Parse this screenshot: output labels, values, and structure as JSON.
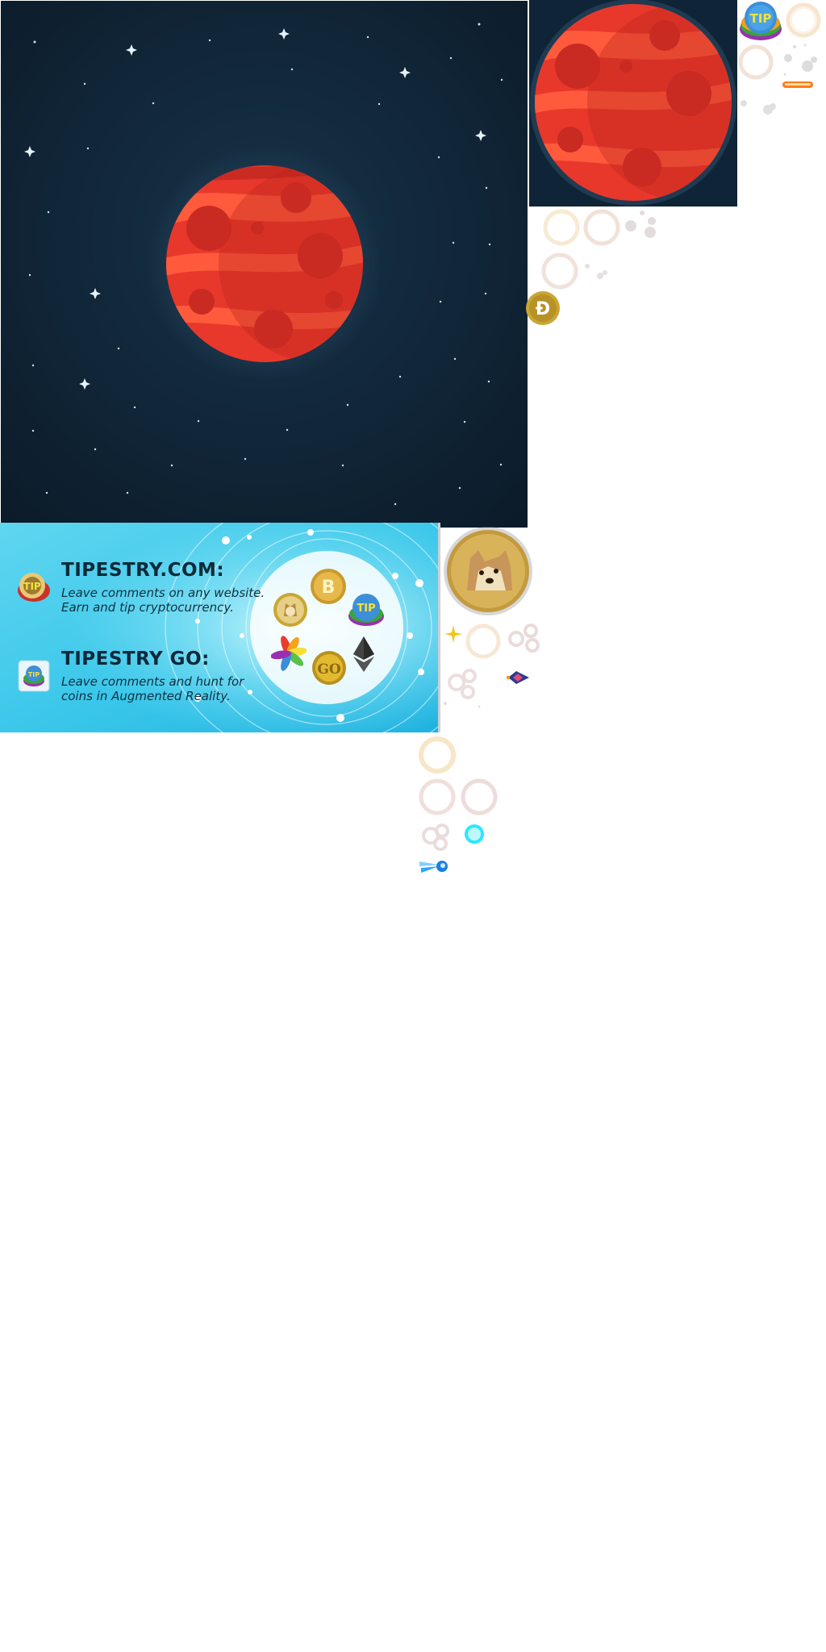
{
  "atlas": {
    "type": "sprite-sheet",
    "background": "#ffffff"
  },
  "sprites": {
    "space_background": {
      "name": "space-background-with-red-planet",
      "bg_color": "#0f2436",
      "star_color": "#cfe6f0"
    },
    "planet_large": {
      "name": "red-planet-icon",
      "colors": [
        "#e8382b",
        "#c92a22",
        "#ff5a3c"
      ]
    },
    "planet_tile": {
      "name": "red-planet-tile",
      "bg_color": "#0f2436"
    },
    "tip_coin": {
      "name": "tip-coin-icon",
      "label": "TIP"
    },
    "doge_coin_small": {
      "name": "dogecoin-d-icon",
      "label": "Ð",
      "color": "#c9a634"
    },
    "doge_coin_large": {
      "name": "doge-face-coin-icon",
      "color": "#d9b35a"
    },
    "bitcoin_coin": {
      "name": "bitcoin-icon",
      "label": "B"
    },
    "go_coin": {
      "name": "go-coin-icon",
      "label": "GO"
    },
    "ethereum": {
      "name": "ethereum-icon"
    },
    "laser_bar": {
      "name": "laser-bar",
      "color": "#ff7a1a"
    },
    "energy_orb": {
      "name": "energy-orb-icon",
      "color": "#2ee6ff"
    },
    "spaceship": {
      "name": "spaceship-icon"
    },
    "comet": {
      "name": "comet-icon",
      "color": "#2aa6ff"
    },
    "sparkle": {
      "name": "sparkle-icon",
      "color": "#f5c518"
    }
  },
  "banner": {
    "line1_title": "TIPESTRY.COM:",
    "line1_text_a": "Leave comments on any website.",
    "line1_text_b": "Earn and tip cryptocurrency.",
    "line2_title": "TIPESTRY GO:",
    "line2_text_a": "Leave comments and hunt for",
    "line2_text_b": "coins in Augmented Reality.",
    "bg_colors": [
      "#29c3e8",
      "#7fe3f5"
    ]
  }
}
